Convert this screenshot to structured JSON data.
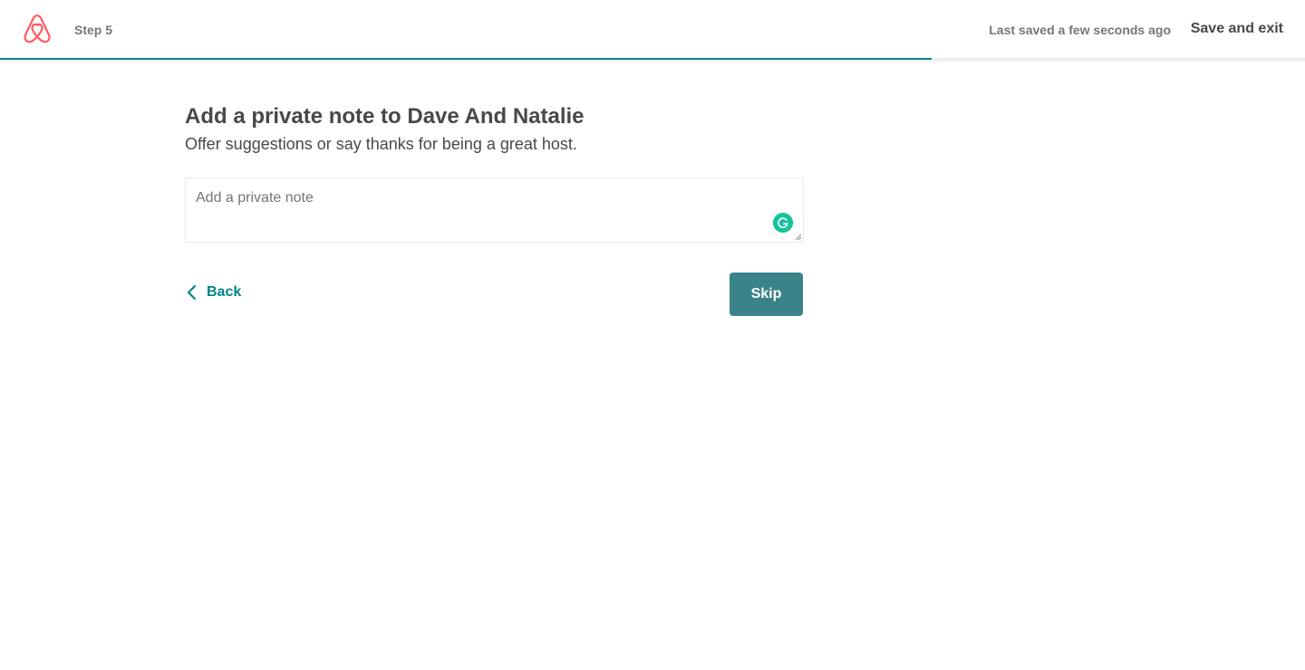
{
  "header": {
    "logo_icon": "airbnb-logo-icon",
    "step_label": "Step 5",
    "last_saved": "Last saved a few seconds ago",
    "save_exit_label": "Save and exit",
    "progress_fraction": 0.714
  },
  "main": {
    "title": "Add a private note to Dave And Natalie",
    "subtitle": "Offer suggestions or say thanks for being a great host.",
    "note": {
      "value": "",
      "placeholder": "Add a private note",
      "grammarly_icon": "grammarly-icon"
    },
    "back_label": "Back",
    "back_icon": "chevron-left-icon",
    "skip_label": "Skip"
  },
  "colors": {
    "brand": "#FF5A5F",
    "accent": "#008489",
    "button": "#3A8489",
    "text": "#484848",
    "muted": "#767676",
    "grammarly": "#15C39A"
  }
}
